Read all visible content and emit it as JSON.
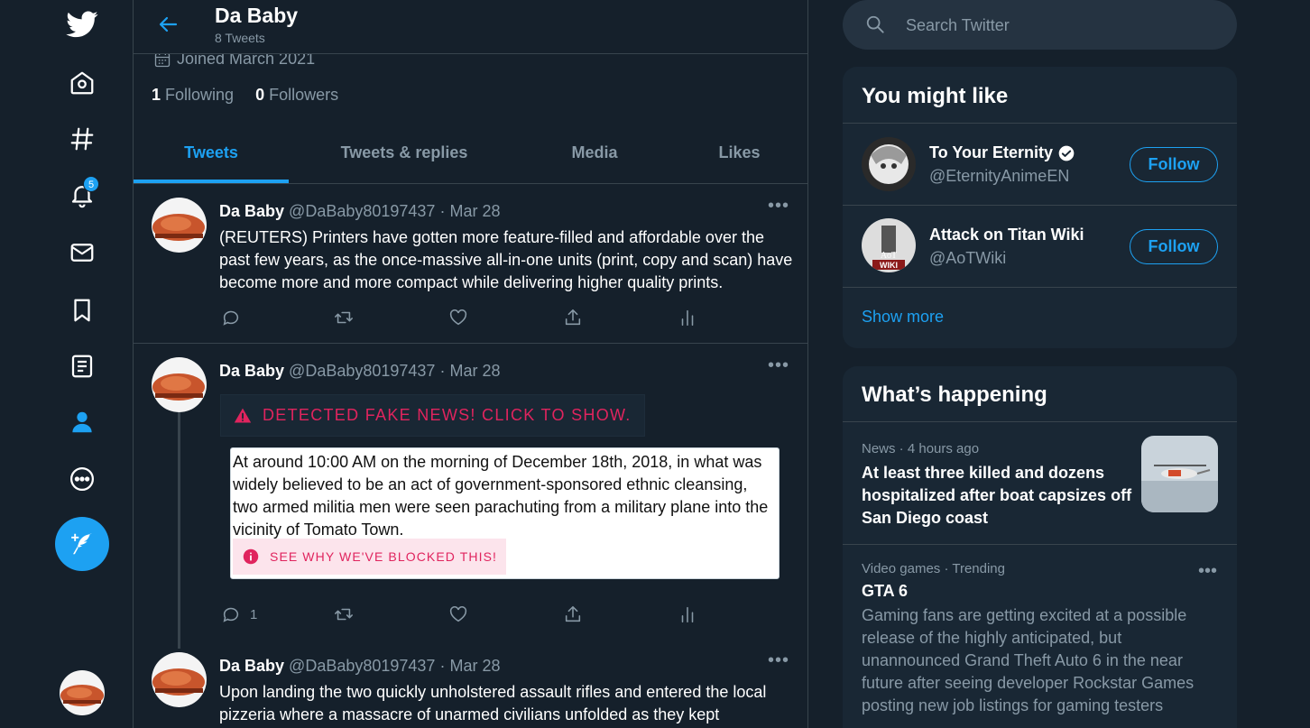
{
  "nav": {
    "items": [
      "twitter-logo",
      "home",
      "explore",
      "notifications",
      "messages",
      "bookmarks",
      "lists",
      "profile",
      "more"
    ],
    "notifications_badge": "5",
    "accent": "#1da1f2"
  },
  "header": {
    "title": "Da Baby",
    "subtitle": "8 Tweets"
  },
  "profile": {
    "joined": "Joined March 2021",
    "following_count": "1",
    "following_label": "Following",
    "followers_count": "0",
    "followers_label": "Followers"
  },
  "tabs": [
    {
      "label": "Tweets",
      "active": true
    },
    {
      "label": "Tweets & replies",
      "active": false
    },
    {
      "label": "Media",
      "active": false
    },
    {
      "label": "Likes",
      "active": false
    }
  ],
  "tweets": [
    {
      "name": "Da Baby",
      "handle": "@DaBaby80197437",
      "date": "· Mar 28",
      "text": "(REUTERS) Printers have gotten more feature-filled and affordable over the past few years, as the once-massive all-in-one units (print, copy and scan) have become more and more compact while delivering higher quality prints.",
      "reply_count": ""
    },
    {
      "name": "Da Baby",
      "handle": "@DaBaby80197437",
      "date": "· Mar 28",
      "fake_banner": "DETECTED FAKE NEWS! CLICK TO SHOW.",
      "card_text": "At around 10:00 AM on the morning of December 18th, 2018, in what was widely believed to be an act of government-sponsored ethnic cleansing, two armed militia men were seen parachuting from a military plane into the vicinity of Tomato Town.",
      "card_button": "SEE WHY WE'VE BLOCKED THIS!",
      "reply_count": "1"
    },
    {
      "name": "Da Baby",
      "handle": "@DaBaby80197437",
      "date": "· Mar 28",
      "text": "Upon landing the two quickly unholstered assault rifles and entered the local pizzeria where a massacre of unarmed civilians unfolded as they kept"
    }
  ],
  "search": {
    "placeholder": "Search Twitter"
  },
  "you_might_like": {
    "title": "You might like",
    "accounts": [
      {
        "name": "To Your Eternity",
        "handle": "@EternityAnimeEN",
        "verified": true,
        "button": "Follow"
      },
      {
        "name": "Attack on Titan Wiki",
        "handle": "@AoTWiki",
        "verified": false,
        "button": "Follow",
        "avatar_text": "AoT WIKI"
      }
    ],
    "show_more": "Show more"
  },
  "whats_happening": {
    "title": "What’s happening",
    "trends": [
      {
        "meta": "News · 4 hours ago",
        "title": "At least three killed and dozens hospitalized after boat capsizes off San Diego coast"
      },
      {
        "meta": "Video games · Trending",
        "title": "GTA 6",
        "body": "Gaming fans are getting excited at a possible release of the highly anticipated, but unannounced Grand Theft Auto 6 in the near future after seeing developer Rockstar Games posting new job listings for gaming testers"
      }
    ]
  }
}
